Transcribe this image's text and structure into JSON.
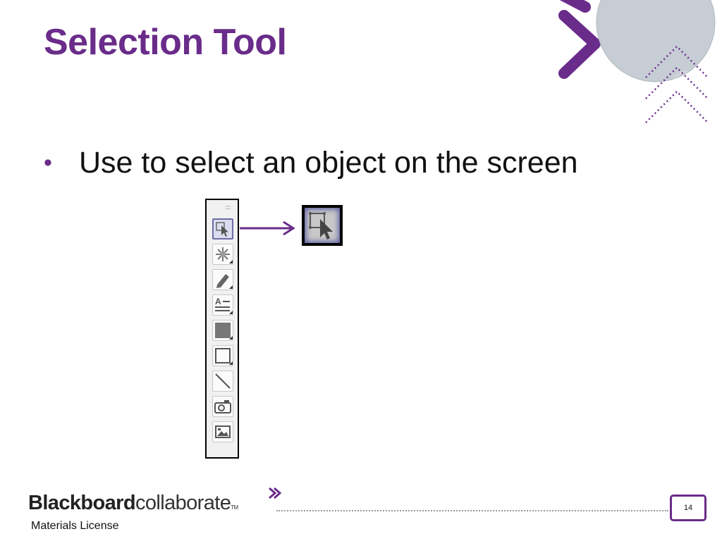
{
  "slide": {
    "title": "Selection Tool",
    "bullets": [
      "Use to select an object on the screen"
    ],
    "page_number": "14"
  },
  "footer": {
    "logo_bold": "Blackboard",
    "logo_light": "collaborate",
    "logo_tm": "TM",
    "license_text": "Materials License"
  },
  "toolbar": {
    "tools": [
      {
        "name": "selection-tool",
        "icon": "selection-arrow-icon",
        "active": true
      },
      {
        "name": "explode-tool",
        "icon": "starburst-icon",
        "active": false
      },
      {
        "name": "pencil-tool",
        "icon": "pencil-icon",
        "active": false
      },
      {
        "name": "text-tool",
        "icon": "text-lines-icon",
        "active": false
      },
      {
        "name": "filled-rectangle-tool",
        "icon": "filled-rectangle-icon",
        "active": false
      },
      {
        "name": "rectangle-tool",
        "icon": "rectangle-outline-icon",
        "active": false
      },
      {
        "name": "line-tool",
        "icon": "diagonal-line-icon",
        "active": false
      },
      {
        "name": "screen-capture-tool",
        "icon": "camera-icon",
        "active": false
      },
      {
        "name": "clip-art-tool",
        "icon": "picture-icon",
        "active": false
      }
    ],
    "tool_label_text": "A"
  },
  "colors": {
    "accent": "#6a2c8a",
    "deco_circle": "#c6cdd4",
    "active_tool_border": "#6d6da6"
  }
}
